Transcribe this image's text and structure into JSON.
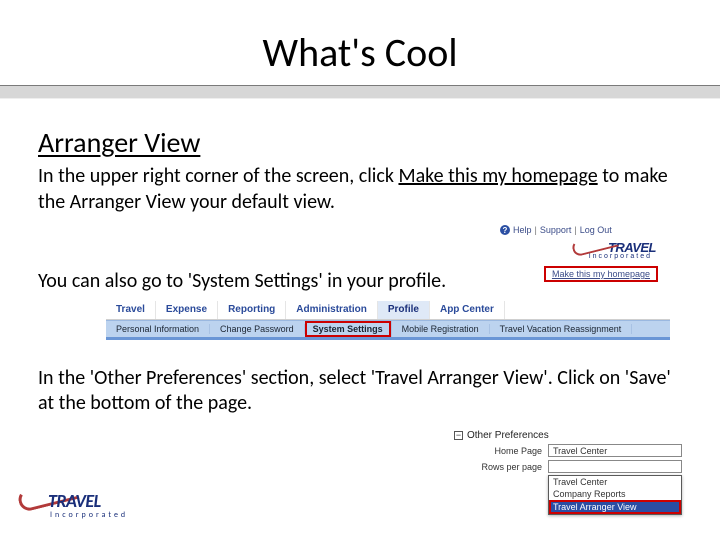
{
  "title": "What's Cool",
  "section_heading": "Arranger View",
  "para1_pre": "In the upper right corner of the screen, click ",
  "para1_link": "Make this my homepage",
  "para1_post": " to make the Arranger View your default view.",
  "para2": "You can also go to 'System Settings' in your profile.",
  "para3": "In the 'Other Preferences' section, select 'Travel Arranger View'.  Click on 'Save' at the bottom of the page.",
  "shot1": {
    "help": "Help",
    "support": "Support",
    "logout": "Log Out",
    "brand": "TRAVEL",
    "inc": "Incorporated",
    "link": "Make this my homepage"
  },
  "shot2": {
    "tabs": [
      "Travel",
      "Expense",
      "Reporting",
      "Administration",
      "Profile",
      "App Center"
    ],
    "sub": [
      "Personal Information",
      "Change Password",
      "System Settings",
      "Mobile Registration",
      "Travel Vacation Reassignment"
    ]
  },
  "shot3": {
    "collapse_glyph": "−",
    "heading": "Other Preferences",
    "row1_label": "Home Page",
    "row1_value": "Travel Center",
    "row2_label": "Rows per page",
    "row2_value": "",
    "opts": [
      "Travel Center",
      "Company Reports",
      "Travel Arranger View"
    ]
  },
  "footer_logo": {
    "brand": "TRAVEL",
    "inc": "Incorporated"
  }
}
